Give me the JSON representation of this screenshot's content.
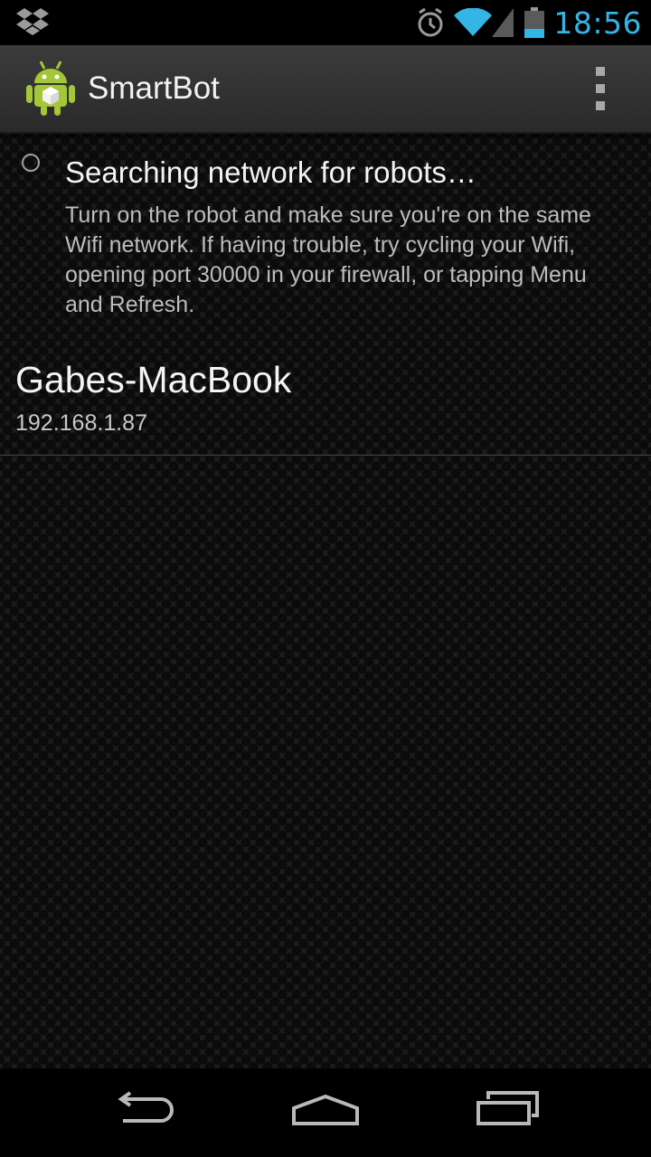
{
  "status_bar": {
    "time": "18:56",
    "icons": [
      "dropbox-icon",
      "alarm-icon",
      "wifi-icon",
      "signal-icon",
      "battery-icon"
    ]
  },
  "action_bar": {
    "title": "SmartBot",
    "app_icon": "android-robot-icon",
    "overflow_icon": "overflow-menu-icon"
  },
  "search": {
    "title": "Searching network for robots…",
    "description": "Turn on the robot and make sure you're on the same Wifi network. If having trouble, try cycling your Wifi, opening port 30000 in your firewall, or tapping Menu and Refresh."
  },
  "devices": [
    {
      "name": "Gabes-MacBook",
      "ip": "192.168.1.87"
    }
  ],
  "nav_bar": {
    "icons": [
      "back-icon",
      "home-icon",
      "recent-apps-icon"
    ]
  },
  "colors": {
    "accent": "#33b5e5",
    "android_green": "#a4c639"
  }
}
